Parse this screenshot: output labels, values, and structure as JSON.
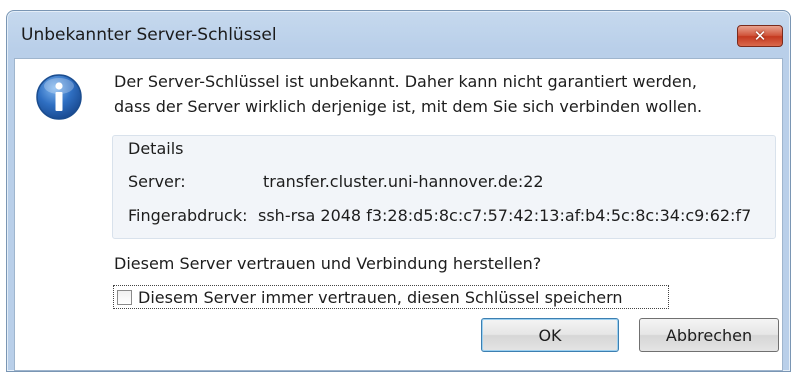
{
  "window": {
    "title": "Unbekannter Server-Schlüssel",
    "close_glyph": "✕"
  },
  "message": {
    "line1": "Der Server-Schlüssel ist unbekannt. Daher kann nicht garantiert werden,",
    "line2": "dass der Server wirklich derjenige ist, mit dem Sie sich verbinden wollen.",
    "icon": "info-icon"
  },
  "details": {
    "title": "Details",
    "server_label": "Server:",
    "server_value": "transfer.cluster.uni-hannover.de:22",
    "fingerprint_label": "Fingerabdruck:",
    "fingerprint_value": "ssh-rsa 2048 f3:28:d5:8c:c7:57:42:13:af:b4:5c:8c:34:c9:62:f7"
  },
  "question": "Diesem Server vertrauen und Verbindung herstellen?",
  "checkbox": {
    "label": "Diesem Server immer vertrauen, diesen Schlüssel speichern",
    "checked": false
  },
  "buttons": {
    "ok": "OK",
    "cancel": "Abbrechen"
  },
  "colors": {
    "accent": "#3c7fb1",
    "close": "#c4381f",
    "titlebar": "#b9cfe9"
  }
}
